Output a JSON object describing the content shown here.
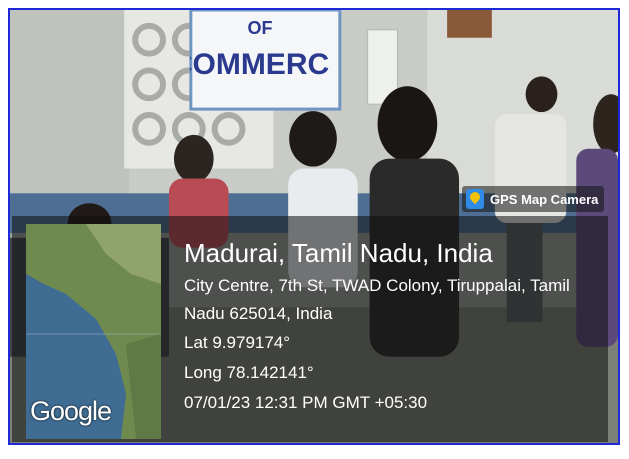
{
  "banner": {
    "text": "COMMERCE",
    "top_word": "OF"
  },
  "app_tag": {
    "name": "GPS Map Camera",
    "icon": "map-pin-icon"
  },
  "location": {
    "city": "Madurai, Tamil Nadu, India",
    "address": "City Centre, 7th St, TWAD Colony, Tiruppalai, Tamil Nadu 625014, India",
    "lat": "Lat 9.979174°",
    "long": "Long 78.142141°",
    "datetime": "07/01/23 12:31 PM GMT +05:30"
  },
  "map": {
    "attribution": "Google"
  },
  "colors": {
    "frame_border": "#1e2ad8",
    "banner_text": "#2b3a8f"
  }
}
